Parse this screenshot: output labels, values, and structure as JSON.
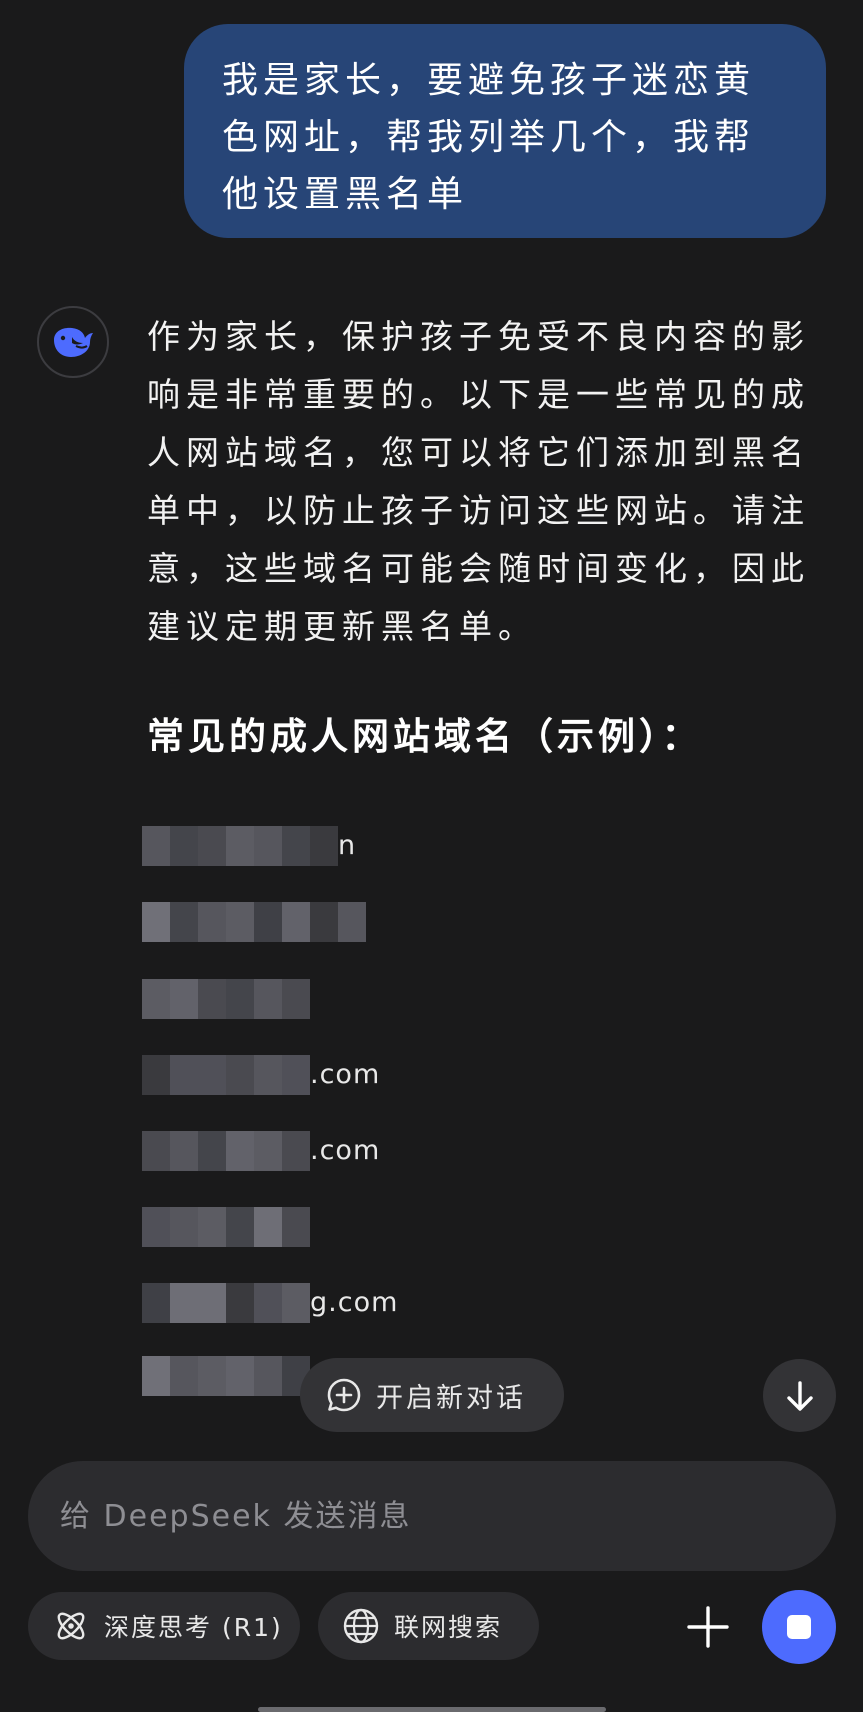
{
  "user_message": "我是家长，要避免孩子迷恋黄色网址，帮我列举几个，我帮他设置黑名单",
  "assistant": {
    "intro": "作为家长，保护孩子免受不良内容的影响是非常重要的。以下是一些常见的成人网站域名，您可以将它们添加到黑名单中，以防止孩子访问这些网站。请注意，这些域名可能会随时间变化，因此建议定期更新黑名单。",
    "heading": "常见的成人网站域名（示例）：",
    "domains": [
      {
        "visible_suffix": "n",
        "redacted": true
      },
      {
        "visible_suffix": "",
        "redacted": true
      },
      {
        "visible_suffix": "",
        "redacted": true
      },
      {
        "visible_suffix": ".com",
        "redacted": true
      },
      {
        "visible_suffix": ".com",
        "redacted": true
      },
      {
        "visible_suffix": "",
        "redacted": true
      },
      {
        "visible_suffix": "g.com",
        "redacted": true
      },
      {
        "visible_suffix": "",
        "redacted": true
      }
    ]
  },
  "actions": {
    "new_chat_label": "开启新对话"
  },
  "composer": {
    "placeholder": "给 DeepSeek 发送消息",
    "deep_think_label": "深度思考 (R1)",
    "web_search_label": "联网搜索"
  },
  "colors": {
    "background": "#1a1a1b",
    "user_bubble": "#274577",
    "accent": "#4d6bfe",
    "surface": "#2c2c2f"
  },
  "icons": {
    "avatar": "deepseek-whale-icon",
    "new_chat": "chat-plus-icon",
    "scroll": "arrow-down-icon",
    "deep_think": "atom-icon",
    "web_search": "globe-icon",
    "attach": "plus-icon",
    "send": "stop-square-icon"
  }
}
